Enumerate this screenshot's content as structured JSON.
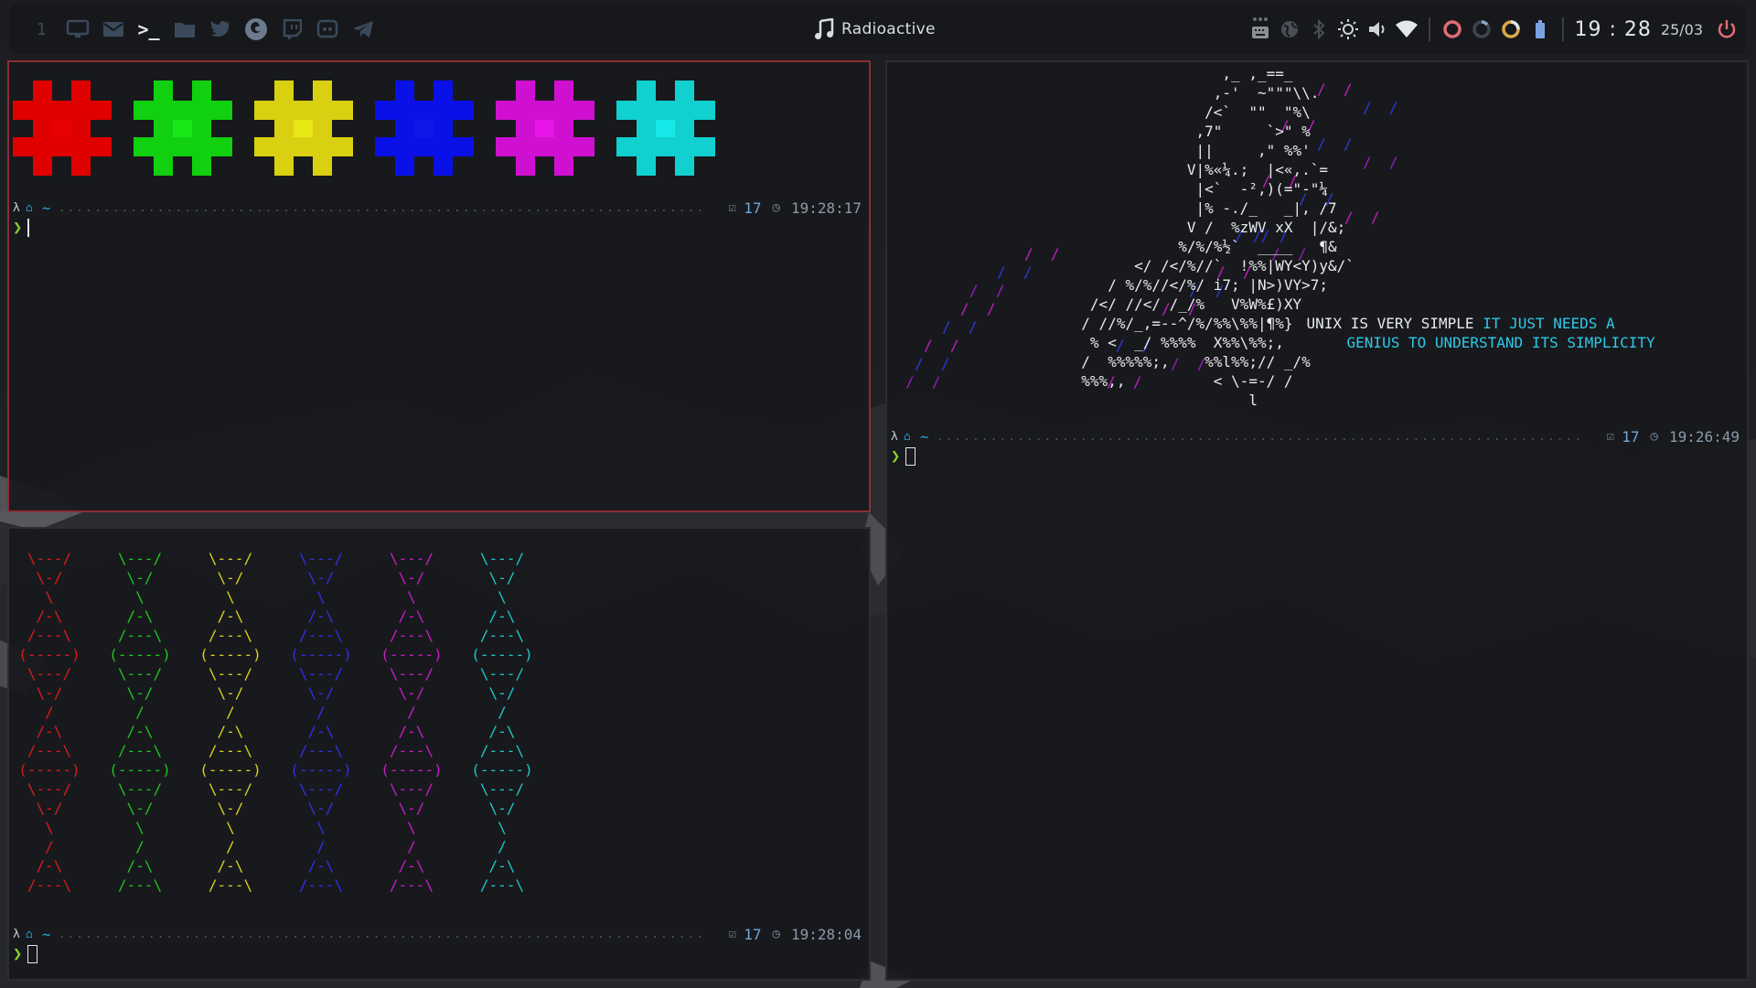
{
  "topbar": {
    "workspaces": [
      {
        "label": "1",
        "icon": "numeral-1"
      },
      {
        "label": "",
        "icon": "monitor-icon"
      },
      {
        "label": "",
        "icon": "mail-icon"
      },
      {
        "label": ">_",
        "icon": "terminal-icon",
        "active": true
      },
      {
        "label": "",
        "icon": "folder-icon"
      },
      {
        "label": "",
        "icon": "twitter-icon"
      },
      {
        "label": "",
        "icon": "firefox-icon"
      },
      {
        "label": "",
        "icon": "twitch-icon"
      },
      {
        "label": "",
        "icon": "discord-icon"
      },
      {
        "label": "",
        "icon": "telegram-icon"
      }
    ],
    "now_playing": "Radioactive",
    "clock": "19 : 28",
    "date": "25/03",
    "tray": [
      "keyboard-icon",
      "globe-icon",
      "bluetooth-icon",
      "brightness-icon",
      "volume-icon",
      "wifi-icon"
    ],
    "indicators": [
      "cpu-ring",
      "memory-ring",
      "disk-ring",
      "battery-icon"
    ],
    "colors": {
      "bar_bg": "#17181b",
      "accent": "#e06c75",
      "focused_border": "#8a2e38"
    }
  },
  "term1": {
    "colors": [
      "#e00000",
      "#10d010",
      "#d8d010",
      "#0a10e8",
      "#d010d0",
      "#10d0d0"
    ],
    "prompt": {
      "tilde": "~",
      "dots": "........................................................................",
      "jobs": "17",
      "time": "19:28:17"
    },
    "arrow": "❯"
  },
  "term2": {
    "rows": [
      "\\---/",
      " \\-/ ",
      "  \\  ",
      " /-\\ ",
      "/---\\",
      "(-----)",
      "\\---/",
      " \\-/ ",
      "  /  ",
      " /-\\ ",
      "/---\\",
      "(-----)",
      "\\---/",
      " \\-/ ",
      "  \\  ",
      "  /  ",
      " /-\\ ",
      "/---\\"
    ],
    "colors": [
      "#d81c1c",
      "#1cc81c",
      "#d8d01c",
      "#3030e8",
      "#c81cc8",
      "#1cc8c8"
    ],
    "prompt": {
      "tilde": "~",
      "dots": "........................................................................",
      "jobs": "17",
      "time": "19:28:04"
    },
    "arrow": "❯"
  },
  "term3": {
    "motto_line1_white": "UNIX IS VERY SIMPLE ",
    "motto_line1_cyan": "IT JUST NEEDS A",
    "motto_line2_cyan": "GENIUS TO UNDERSTAND ITS SIMPLICITY",
    "ascii_lines": [
      "                       ,_ ,_==_",
      "                      ,-'  ~\"\"\"\\\\.",
      "                     /<`  \"\"  \"%\\",
      "                    ,7\"     `>\" %",
      "                    ||     ,\" %%'",
      "                   V|%«¼.;  |<«,.`=",
      "                    |<`  -²,)(=\"-\"¼",
      "                    |% -./_   _|, /7",
      "                   V /  %zWV xX  |/&;",
      "                  %/%/%½`  ____   ¶&",
      "             </ /</%//`  !%%|WY<Y)y&/`",
      "          / %/%//</%/ i7; |N>)VY>7;",
      "        /</ //</ /_/%   V%W%£)XY",
      "       / //%/_,=--^/%/%%\\%%|¶%}",
      "        % <  _/ %%%%  X%%\\%%;,",
      "       /  %%%%%;,    %%l%%;// _/%",
      "       %%%,,          < \\-=-/ /",
      "                          l"
    ],
    "rain": "/ / / > / >/% > %/%// / // ///>// />/ / />//%/% / %/>/ /> ;//% & / / ;",
    "prompt": {
      "tilde": "~",
      "dots": "........................................................................",
      "jobs": "17",
      "time": "19:26:49"
    },
    "arrow": "❯"
  }
}
